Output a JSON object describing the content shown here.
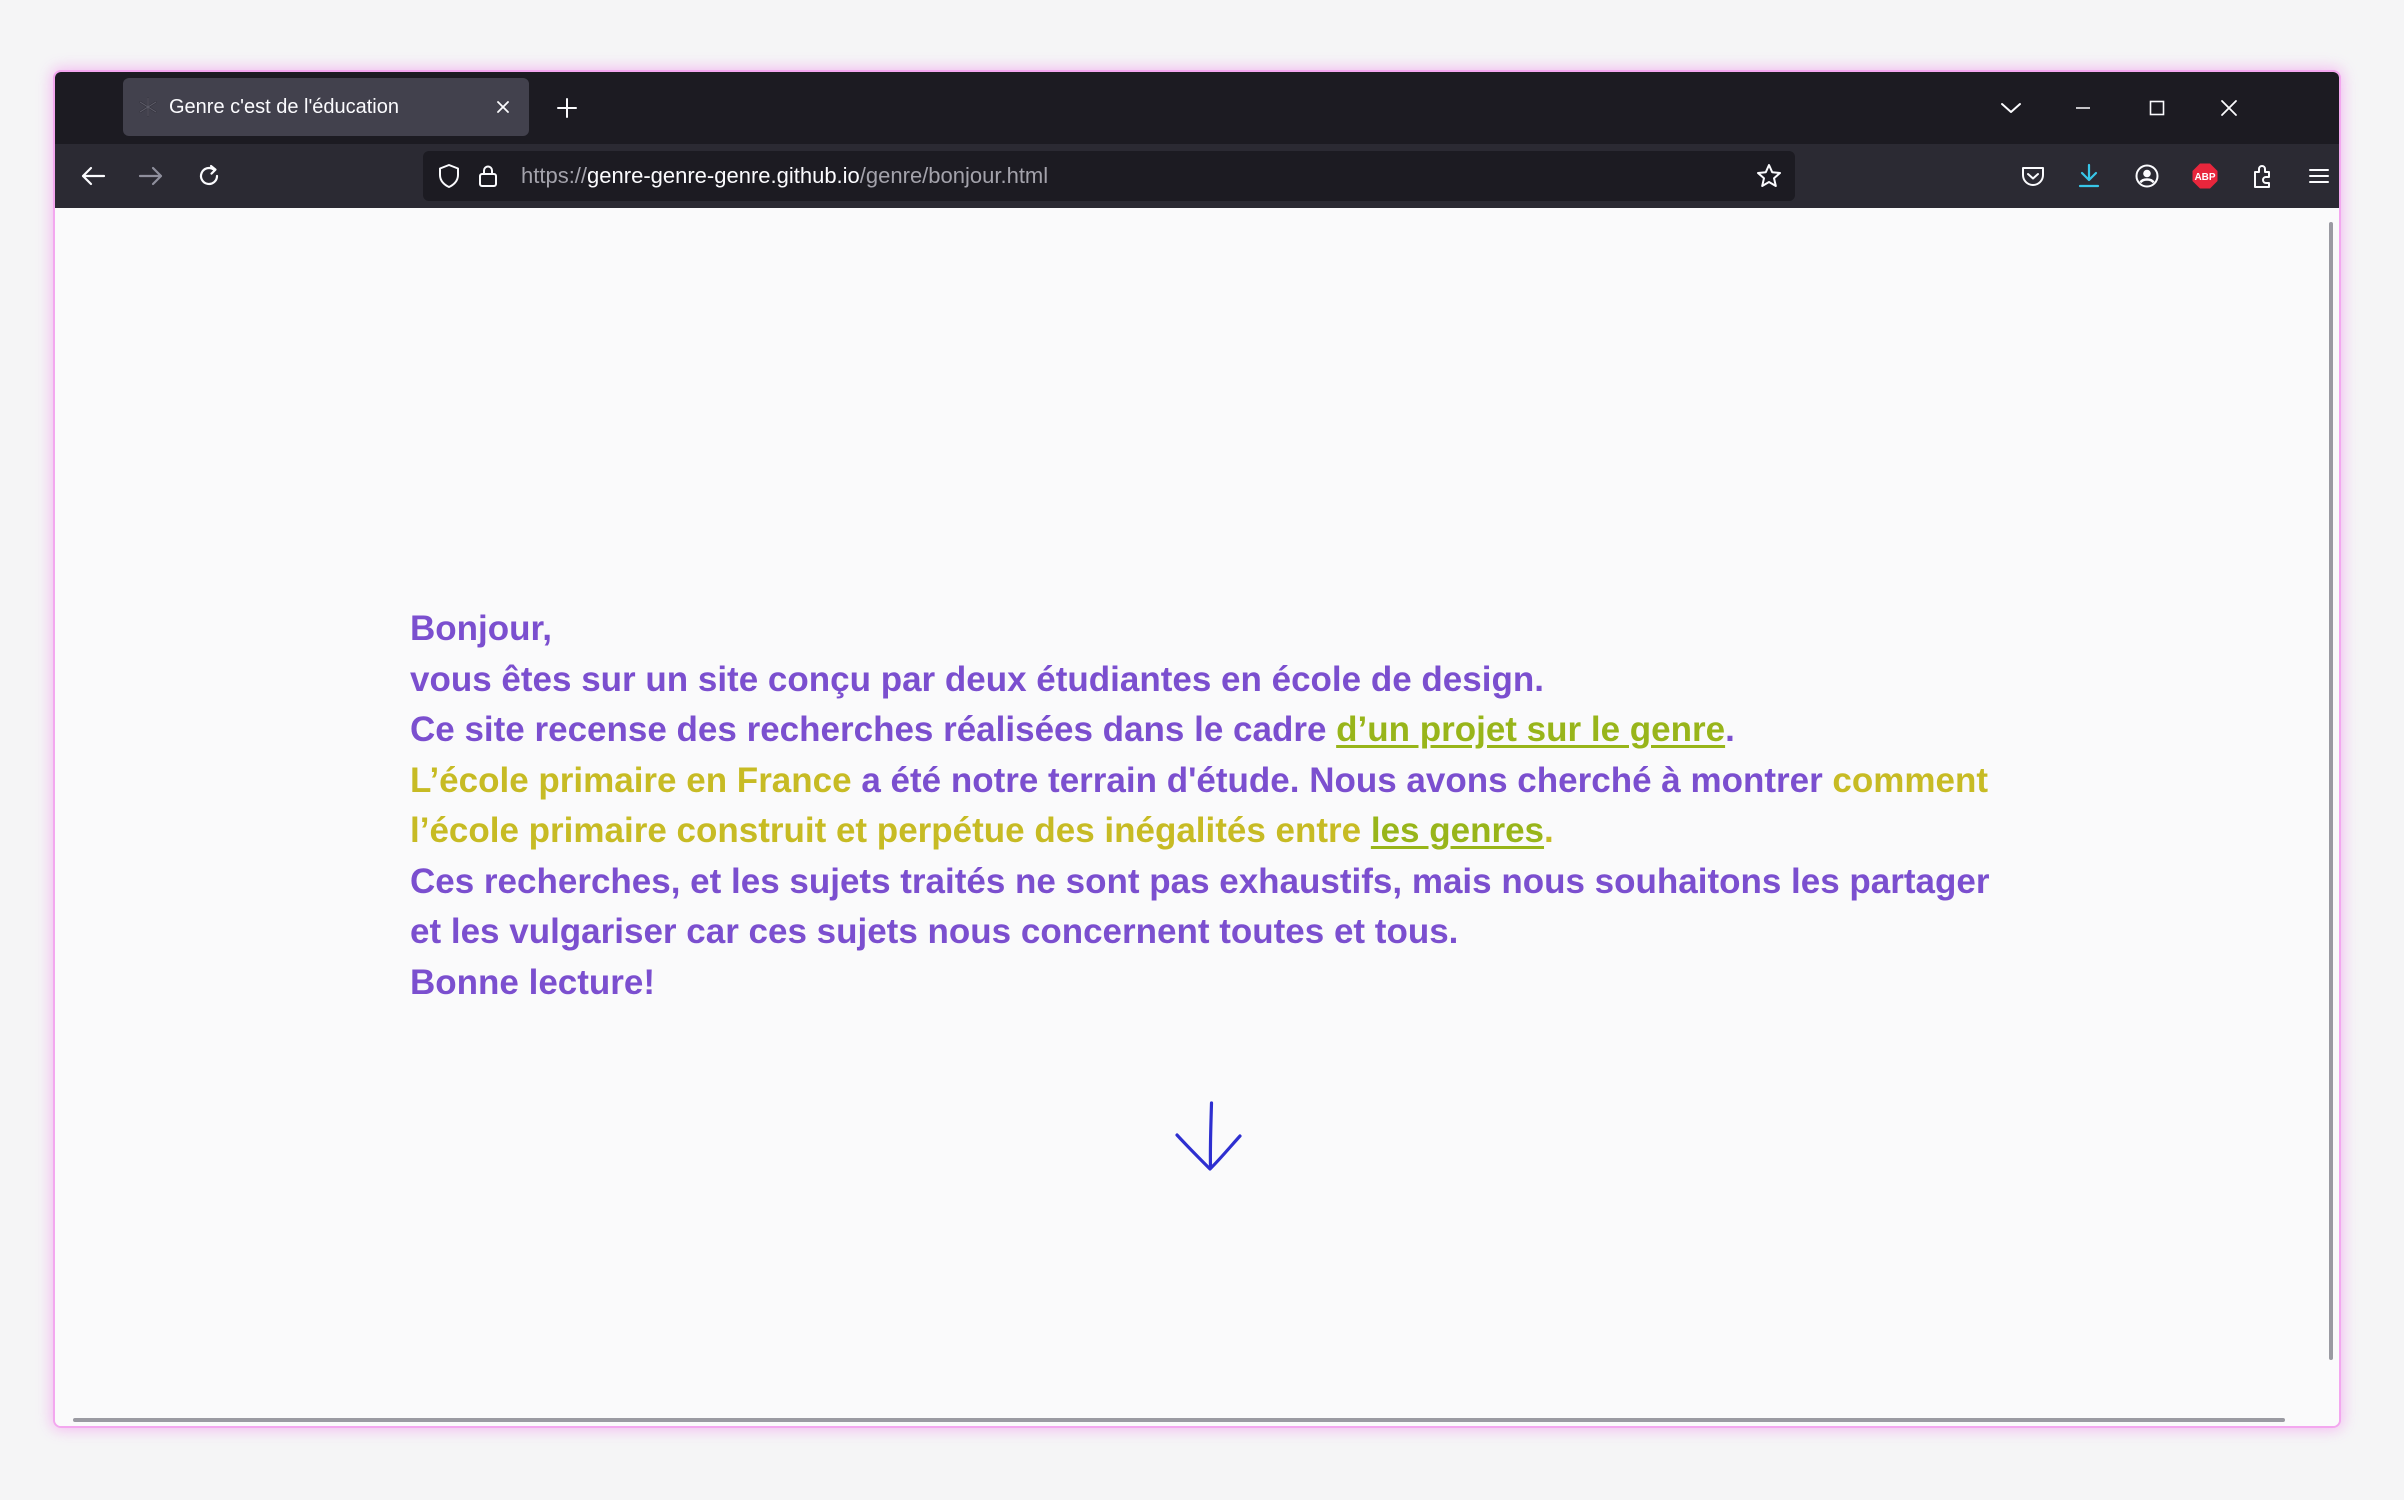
{
  "browser": {
    "tab": {
      "title": "Genre c'est de l'éducation"
    },
    "url": {
      "scheme": "https://",
      "host": "genre-genre-genre.github.io",
      "path": "/genre/bonjour.html"
    },
    "toolbar_icons": [
      "back-icon",
      "forward-icon",
      "reload-icon",
      "shield-icon",
      "lock-icon",
      "bookmark-star-icon",
      "pocket-icon",
      "download-icon",
      "account-icon",
      "adblock-icon",
      "extensions-icon",
      "menu-icon"
    ],
    "adblock_badge": "ABP"
  },
  "page": {
    "greeting": "Bonjour,",
    "line1": "vous êtes sur un site conçu par deux étudiantes en école de design.",
    "line2_start": "Ce site recense des recherches réalisées dans le cadre ",
    "line2_link": "d’un projet sur le genre",
    "line2_end": ".",
    "line3_highlight1": "L’école primaire en France",
    "line3_mid": " a été notre terrain d'étude. Nous avons cherché à montrer ",
    "line3_highlight2": "comment l’école primaire construit et perpétue des inégalités entre ",
    "line3_link": "les genres",
    "line3_end": ".",
    "line4": "Ces recherches, et les sujets traités ne sont pas exhaustifs, mais nous souhaitons les partager et les vulgariser car ces sujets nous concernent toutes et tous.",
    "closing": "Bonne lecture!"
  },
  "colors": {
    "purple_text": "#7b4fcf",
    "yellow_highlight": "#c7bb24",
    "green_link": "#98b51a",
    "arrow_blue": "#2e2fd0",
    "window_glow": "#f3a7ef"
  }
}
